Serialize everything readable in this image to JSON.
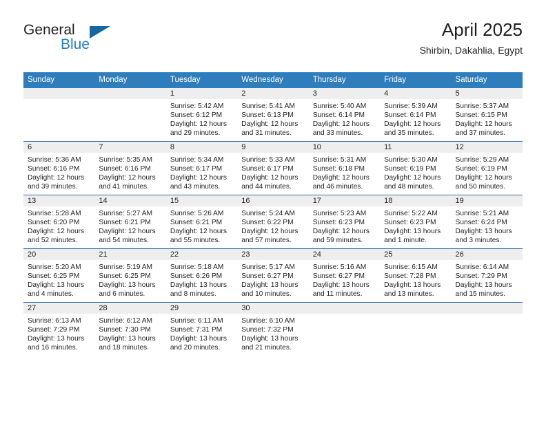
{
  "brand": {
    "name_part1": "General",
    "name_part2": "Blue",
    "accent_color": "#1f7fc4",
    "triangle_color": "#17669f"
  },
  "header": {
    "title": "April 2025",
    "subtitle": "Shirbin, Dakahlia, Egypt"
  },
  "calendar": {
    "header_bg": "#2e7dbd",
    "daynum_bg": "#eeeeee",
    "row_border": "#2e6da8",
    "weekdays": [
      "Sunday",
      "Monday",
      "Tuesday",
      "Wednesday",
      "Thursday",
      "Friday",
      "Saturday"
    ],
    "weeks": [
      [
        {
          "day": "",
          "sunrise": "",
          "sunset": "",
          "daylight_line1": "",
          "daylight_line2": ""
        },
        {
          "day": "",
          "sunrise": "",
          "sunset": "",
          "daylight_line1": "",
          "daylight_line2": ""
        },
        {
          "day": "1",
          "sunrise": "Sunrise: 5:42 AM",
          "sunset": "Sunset: 6:12 PM",
          "daylight_line1": "Daylight: 12 hours",
          "daylight_line2": "and 29 minutes."
        },
        {
          "day": "2",
          "sunrise": "Sunrise: 5:41 AM",
          "sunset": "Sunset: 6:13 PM",
          "daylight_line1": "Daylight: 12 hours",
          "daylight_line2": "and 31 minutes."
        },
        {
          "day": "3",
          "sunrise": "Sunrise: 5:40 AM",
          "sunset": "Sunset: 6:14 PM",
          "daylight_line1": "Daylight: 12 hours",
          "daylight_line2": "and 33 minutes."
        },
        {
          "day": "4",
          "sunrise": "Sunrise: 5:39 AM",
          "sunset": "Sunset: 6:14 PM",
          "daylight_line1": "Daylight: 12 hours",
          "daylight_line2": "and 35 minutes."
        },
        {
          "day": "5",
          "sunrise": "Sunrise: 5:37 AM",
          "sunset": "Sunset: 6:15 PM",
          "daylight_line1": "Daylight: 12 hours",
          "daylight_line2": "and 37 minutes."
        }
      ],
      [
        {
          "day": "6",
          "sunrise": "Sunrise: 5:36 AM",
          "sunset": "Sunset: 6:16 PM",
          "daylight_line1": "Daylight: 12 hours",
          "daylight_line2": "and 39 minutes."
        },
        {
          "day": "7",
          "sunrise": "Sunrise: 5:35 AM",
          "sunset": "Sunset: 6:16 PM",
          "daylight_line1": "Daylight: 12 hours",
          "daylight_line2": "and 41 minutes."
        },
        {
          "day": "8",
          "sunrise": "Sunrise: 5:34 AM",
          "sunset": "Sunset: 6:17 PM",
          "daylight_line1": "Daylight: 12 hours",
          "daylight_line2": "and 43 minutes."
        },
        {
          "day": "9",
          "sunrise": "Sunrise: 5:33 AM",
          "sunset": "Sunset: 6:17 PM",
          "daylight_line1": "Daylight: 12 hours",
          "daylight_line2": "and 44 minutes."
        },
        {
          "day": "10",
          "sunrise": "Sunrise: 5:31 AM",
          "sunset": "Sunset: 6:18 PM",
          "daylight_line1": "Daylight: 12 hours",
          "daylight_line2": "and 46 minutes."
        },
        {
          "day": "11",
          "sunrise": "Sunrise: 5:30 AM",
          "sunset": "Sunset: 6:19 PM",
          "daylight_line1": "Daylight: 12 hours",
          "daylight_line2": "and 48 minutes."
        },
        {
          "day": "12",
          "sunrise": "Sunrise: 5:29 AM",
          "sunset": "Sunset: 6:19 PM",
          "daylight_line1": "Daylight: 12 hours",
          "daylight_line2": "and 50 minutes."
        }
      ],
      [
        {
          "day": "13",
          "sunrise": "Sunrise: 5:28 AM",
          "sunset": "Sunset: 6:20 PM",
          "daylight_line1": "Daylight: 12 hours",
          "daylight_line2": "and 52 minutes."
        },
        {
          "day": "14",
          "sunrise": "Sunrise: 5:27 AM",
          "sunset": "Sunset: 6:21 PM",
          "daylight_line1": "Daylight: 12 hours",
          "daylight_line2": "and 54 minutes."
        },
        {
          "day": "15",
          "sunrise": "Sunrise: 5:26 AM",
          "sunset": "Sunset: 6:21 PM",
          "daylight_line1": "Daylight: 12 hours",
          "daylight_line2": "and 55 minutes."
        },
        {
          "day": "16",
          "sunrise": "Sunrise: 5:24 AM",
          "sunset": "Sunset: 6:22 PM",
          "daylight_line1": "Daylight: 12 hours",
          "daylight_line2": "and 57 minutes."
        },
        {
          "day": "17",
          "sunrise": "Sunrise: 5:23 AM",
          "sunset": "Sunset: 6:23 PM",
          "daylight_line1": "Daylight: 12 hours",
          "daylight_line2": "and 59 minutes."
        },
        {
          "day": "18",
          "sunrise": "Sunrise: 5:22 AM",
          "sunset": "Sunset: 6:23 PM",
          "daylight_line1": "Daylight: 13 hours",
          "daylight_line2": "and 1 minute."
        },
        {
          "day": "19",
          "sunrise": "Sunrise: 5:21 AM",
          "sunset": "Sunset: 6:24 PM",
          "daylight_line1": "Daylight: 13 hours",
          "daylight_line2": "and 3 minutes."
        }
      ],
      [
        {
          "day": "20",
          "sunrise": "Sunrise: 5:20 AM",
          "sunset": "Sunset: 6:25 PM",
          "daylight_line1": "Daylight: 13 hours",
          "daylight_line2": "and 4 minutes."
        },
        {
          "day": "21",
          "sunrise": "Sunrise: 5:19 AM",
          "sunset": "Sunset: 6:25 PM",
          "daylight_line1": "Daylight: 13 hours",
          "daylight_line2": "and 6 minutes."
        },
        {
          "day": "22",
          "sunrise": "Sunrise: 5:18 AM",
          "sunset": "Sunset: 6:26 PM",
          "daylight_line1": "Daylight: 13 hours",
          "daylight_line2": "and 8 minutes."
        },
        {
          "day": "23",
          "sunrise": "Sunrise: 5:17 AM",
          "sunset": "Sunset: 6:27 PM",
          "daylight_line1": "Daylight: 13 hours",
          "daylight_line2": "and 10 minutes."
        },
        {
          "day": "24",
          "sunrise": "Sunrise: 5:16 AM",
          "sunset": "Sunset: 6:27 PM",
          "daylight_line1": "Daylight: 13 hours",
          "daylight_line2": "and 11 minutes."
        },
        {
          "day": "25",
          "sunrise": "Sunrise: 6:15 AM",
          "sunset": "Sunset: 7:28 PM",
          "daylight_line1": "Daylight: 13 hours",
          "daylight_line2": "and 13 minutes."
        },
        {
          "day": "26",
          "sunrise": "Sunrise: 6:14 AM",
          "sunset": "Sunset: 7:29 PM",
          "daylight_line1": "Daylight: 13 hours",
          "daylight_line2": "and 15 minutes."
        }
      ],
      [
        {
          "day": "27",
          "sunrise": "Sunrise: 6:13 AM",
          "sunset": "Sunset: 7:29 PM",
          "daylight_line1": "Daylight: 13 hours",
          "daylight_line2": "and 16 minutes."
        },
        {
          "day": "28",
          "sunrise": "Sunrise: 6:12 AM",
          "sunset": "Sunset: 7:30 PM",
          "daylight_line1": "Daylight: 13 hours",
          "daylight_line2": "and 18 minutes."
        },
        {
          "day": "29",
          "sunrise": "Sunrise: 6:11 AM",
          "sunset": "Sunset: 7:31 PM",
          "daylight_line1": "Daylight: 13 hours",
          "daylight_line2": "and 20 minutes."
        },
        {
          "day": "30",
          "sunrise": "Sunrise: 6:10 AM",
          "sunset": "Sunset: 7:32 PM",
          "daylight_line1": "Daylight: 13 hours",
          "daylight_line2": "and 21 minutes."
        },
        {
          "day": "",
          "sunrise": "",
          "sunset": "",
          "daylight_line1": "",
          "daylight_line2": ""
        },
        {
          "day": "",
          "sunrise": "",
          "sunset": "",
          "daylight_line1": "",
          "daylight_line2": ""
        },
        {
          "day": "",
          "sunrise": "",
          "sunset": "",
          "daylight_line1": "",
          "daylight_line2": ""
        }
      ]
    ]
  }
}
